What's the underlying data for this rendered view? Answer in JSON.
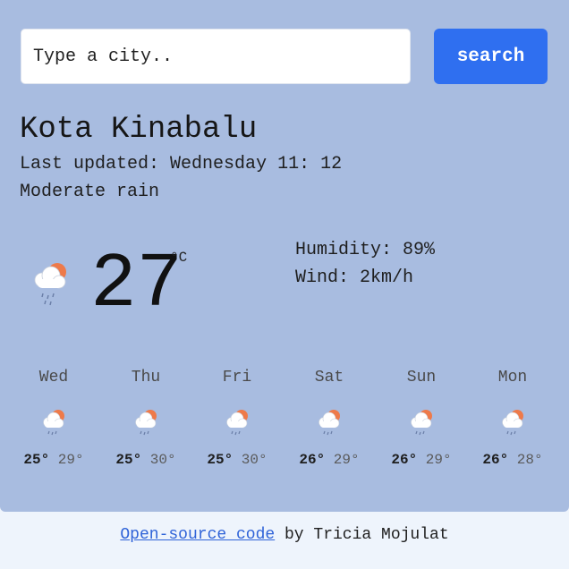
{
  "search": {
    "placeholder": "Type a city..",
    "button_label": "search"
  },
  "current": {
    "city": "Kota Kinabalu",
    "last_updated_label": "Last updated:",
    "last_updated_value": "Wednesday 11: 12",
    "description": "Moderate rain",
    "temperature": "27",
    "unit": "°C",
    "humidity_label": "Humidity:",
    "humidity_value": "89%",
    "wind_label": "Wind:",
    "wind_value": "2km/h",
    "icon": "sun-behind-rain-cloud-icon"
  },
  "forecast": [
    {
      "day": "Wed",
      "max": "25°",
      "min": "29°",
      "icon": "sun-behind-rain-cloud-icon"
    },
    {
      "day": "Thu",
      "max": "25°",
      "min": "30°",
      "icon": "sun-behind-rain-cloud-icon"
    },
    {
      "day": "Fri",
      "max": "25°",
      "min": "30°",
      "icon": "sun-behind-rain-cloud-icon"
    },
    {
      "day": "Sat",
      "max": "26°",
      "min": "29°",
      "icon": "sun-behind-rain-cloud-icon"
    },
    {
      "day": "Sun",
      "max": "26°",
      "min": "29°",
      "icon": "sun-behind-rain-cloud-icon"
    },
    {
      "day": "Mon",
      "max": "26°",
      "min": "28°",
      "icon": "sun-behind-rain-cloud-icon"
    }
  ],
  "footer": {
    "link_text": "Open-source code",
    "suffix": "by Tricia Mojulat"
  },
  "colors": {
    "card_background": "#a8bce0",
    "page_background": "#eef4fc",
    "button": "#2f6ff0",
    "link": "#2f63d8",
    "sun": "#ee7a4a"
  }
}
